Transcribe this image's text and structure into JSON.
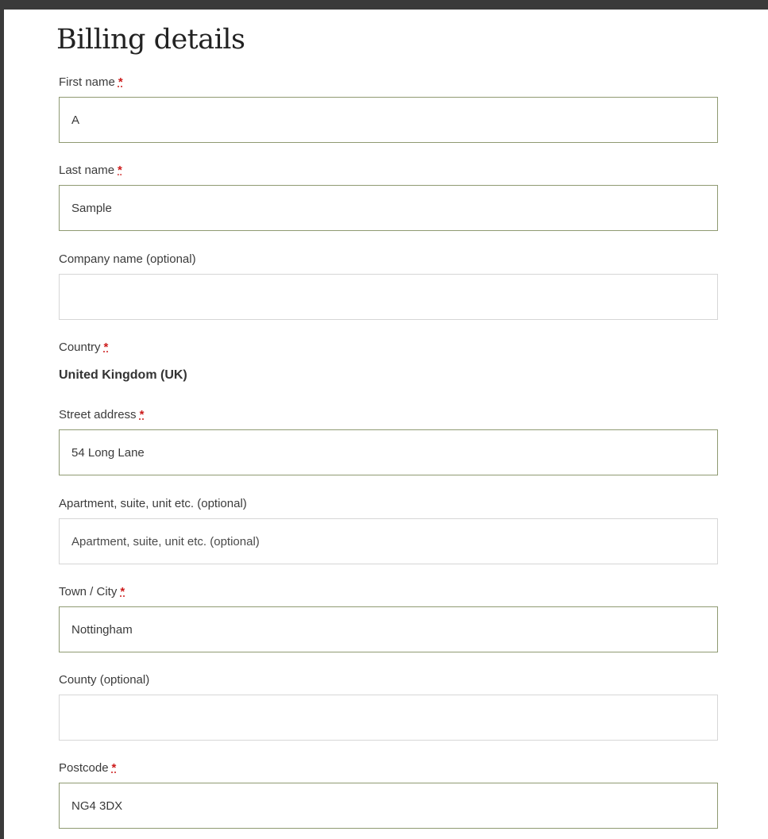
{
  "form": {
    "title": "Billing details",
    "required_mark": "*",
    "first_name": {
      "label": "First name",
      "value": "A"
    },
    "last_name": {
      "label": "Last name",
      "value": "Sample"
    },
    "company": {
      "label": "Company name (optional)",
      "value": ""
    },
    "country": {
      "label": "Country",
      "value": "United Kingdom (UK)"
    },
    "street": {
      "label": "Street address",
      "value": "54 Long Lane"
    },
    "apartment": {
      "label": "Apartment, suite, unit etc. (optional)",
      "placeholder": "Apartment, suite, unit etc. (optional)",
      "value": ""
    },
    "city": {
      "label": "Town / City",
      "value": "Nottingham"
    },
    "county": {
      "label": "County (optional)",
      "value": ""
    },
    "postcode": {
      "label": "Postcode",
      "value": "NG4 3DX"
    }
  },
  "colors": {
    "outer_background": "#3a3a3a",
    "page_background": "#ffffff",
    "filled_border": "#8f9a72",
    "empty_border": "#d6d6d6",
    "required": "#cc1a1a"
  }
}
